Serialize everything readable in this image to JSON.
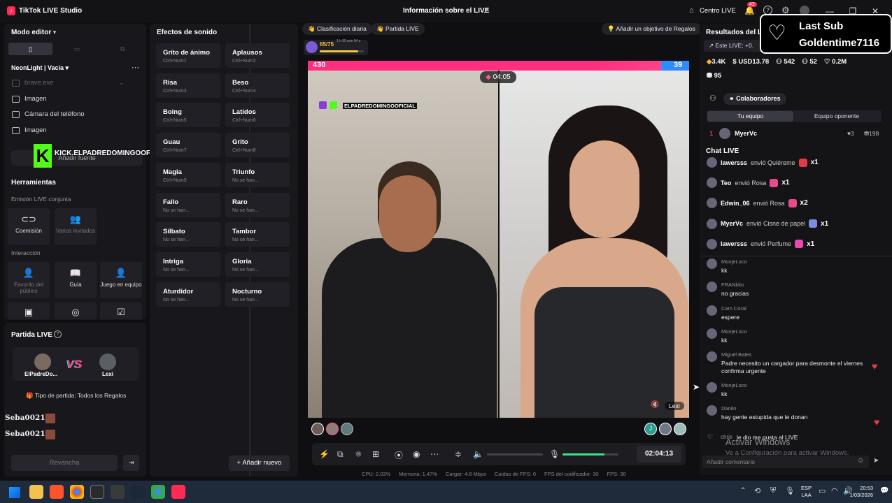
{
  "titlebar": {
    "app_title": "TikTok LIVE Studio",
    "center_title": "Información sobre el LIVE",
    "centro_live": "Centro LIVE",
    "notif_count": "42"
  },
  "left": {
    "modo_editor": "Modo editor",
    "scene": "NeonLight | Vacía",
    "sources": [
      "brave.exe",
      "Imagen",
      "Cámara del teléfono",
      "Imagen"
    ],
    "add_source": "Añadir fuente",
    "kick_overlay": "KICK.ELPADREDOMINGOOFICIALL",
    "herramientas": "Herramientas",
    "emision": "Emisión LIVE conjunta",
    "coemision": "Coemisión",
    "varios": "Varios invitados",
    "interaccion": "Interacción",
    "favorito": "Favorito del público",
    "guia": "Guía",
    "juego": "Juego en equipo"
  },
  "sounds": {
    "title": "Efectos de sonido",
    "items": [
      {
        "n": "Grito de ánimo",
        "k": "Ctrl+Num1"
      },
      {
        "n": "Aplausos",
        "k": "Ctrl+Num2"
      },
      {
        "n": "Risa",
        "k": "Ctrl+Num3"
      },
      {
        "n": "Beso",
        "k": "Ctrl+Num4"
      },
      {
        "n": "Boing",
        "k": "Ctrl+Num5"
      },
      {
        "n": "Latidos",
        "k": "Ctrl+Num6"
      },
      {
        "n": "Guau",
        "k": "Ctrl+Num7"
      },
      {
        "n": "Grito",
        "k": "Ctrl+Num8"
      },
      {
        "n": "Magia",
        "k": "Ctrl+Num9"
      },
      {
        "n": "Triunfo",
        "k": "No se han..."
      },
      {
        "n": "Fallo",
        "k": "No se han..."
      },
      {
        "n": "Raro",
        "k": "No se han..."
      },
      {
        "n": "Silbato",
        "k": "No se han..."
      },
      {
        "n": "Tambor",
        "k": "No se han..."
      },
      {
        "n": "Intriga",
        "k": "No se han..."
      },
      {
        "n": "Gloria",
        "k": "No se han..."
      },
      {
        "n": "Aturdidor",
        "k": "No se han..."
      },
      {
        "n": "Nocturno",
        "k": "No se han..."
      }
    ],
    "add_new": "+ Añadir nuevo"
  },
  "partida": {
    "title": "Partida LIVE",
    "p1": "ElPadreDo...",
    "p2": "Lexi",
    "tipo": "Tipo de partida: Todos los Regalos",
    "rev": "Revancha",
    "seba1": "Seba00210:",
    "seba2": "Seba00210:"
  },
  "center": {
    "clasif": "Clasificación diaria",
    "partida_live": "Partida LIVE",
    "objetivo": "Añadir un objetivo de Regalos",
    "progress": "65/75",
    "timer_small": "1 h 55 min 54 s",
    "score_left": "430",
    "score_right": "39",
    "battle_time": "04:05",
    "watermark": "ELPADREDOMINGOOFICIAL",
    "lexi_tag": "Lexi",
    "duration": "02:04:13"
  },
  "stats": {
    "cpu": "CPU: 2.03%",
    "mem": "Memoria: 1.47%",
    "carga": "Cargar: 4.8 Mbps",
    "caidas": "Caídas de FPS: 0",
    "fps_cod": "FPS del codificador: 30",
    "fps": "FPS: 30"
  },
  "right": {
    "resultados": "Resultados del LI",
    "este_live": "Este LIVE: +0.",
    "diamonds": "3.4K",
    "usd": "USD13.78",
    "viewers": "542",
    "likes": "52",
    "hearts": "0.2M",
    "gifts": "95",
    "colab": "Colaboradores",
    "tu_equipo": "Tu equipo",
    "oponente": "Equipo oponente",
    "rank_name": "MyerVc",
    "rank_likes": "3",
    "rank_pts": "198",
    "chat_title": "Chat LIVE",
    "gifts_list": [
      {
        "u": "lawersss",
        "t": "envió Quiéreme",
        "x": "x1"
      },
      {
        "u": "Teo",
        "t": "envió Rosa",
        "x": "x1"
      },
      {
        "u": "Edwin_06",
        "t": "envió Rosa",
        "x": "x2"
      },
      {
        "u": "MyerVc",
        "t": "envió Cisne de papel",
        "x": "x1"
      },
      {
        "u": "lawersss",
        "t": "envió Perfume",
        "x": "x1"
      }
    ],
    "chat": [
      {
        "u": "MonjeLoco",
        "m": "kk"
      },
      {
        "u": "FRANkito",
        "m": "no gracias"
      },
      {
        "u": "Cam Coral",
        "m": "espere"
      },
      {
        "u": "MonjeLoco",
        "m": "kk"
      },
      {
        "u": "Miguel Bates",
        "m": "Padre necesito un cargador para desmonte el viernes confirma urgente"
      },
      {
        "u": "MonjeLoco",
        "m": "kk"
      },
      {
        "u": "Danilo",
        "m": "hay gente estupida que le donan"
      }
    ],
    "chris": "chris",
    "chris_msg": "le dio me gusta al LIVE",
    "activar": "Activar Windows",
    "activar_sub": "Ve a Configuración para activar Windows.",
    "comment_ph": "Añadir comentario"
  },
  "lastsub": {
    "l1": "Last Sub",
    "l2": "Goldentime7116"
  },
  "taskbar": {
    "lang1": "ESP",
    "lang2": "LAA",
    "time": "20:53",
    "date": "1/03/2026"
  }
}
